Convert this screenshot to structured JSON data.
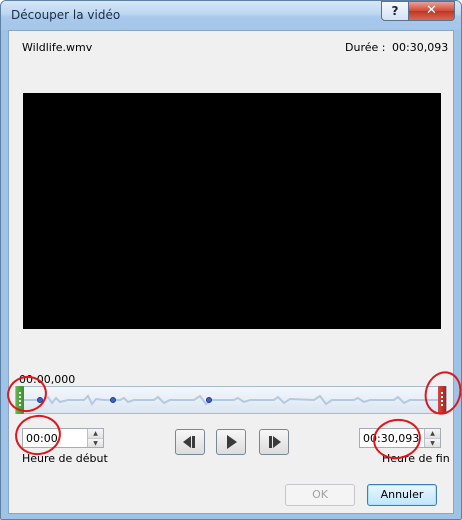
{
  "window": {
    "title": "Découper la vidéo",
    "help_label": "?",
    "close_label": "✕"
  },
  "file": {
    "name": "Wildlife.wmv"
  },
  "duration": {
    "label": "Durée :",
    "value": "00:30,093"
  },
  "trackbar": {
    "position_label": "00:00,000",
    "start_fraction": 0.0,
    "end_fraction": 1.0
  },
  "start": {
    "value": "00:00",
    "label": "Heure de début"
  },
  "end": {
    "value": "00:30,093",
    "label": "Heure de fin"
  },
  "controls": {
    "previous_frame": "previous-frame-icon",
    "play": "play-icon",
    "next_frame": "next-frame-icon"
  },
  "buttons": {
    "ok": "OK",
    "cancel": "Annuler"
  },
  "colors": {
    "title_bar": "#a9c9ec",
    "annotation": "#e0161b",
    "start_handle": "#4fa83c",
    "end_handle": "#c0332a",
    "video_background": "#000000"
  }
}
